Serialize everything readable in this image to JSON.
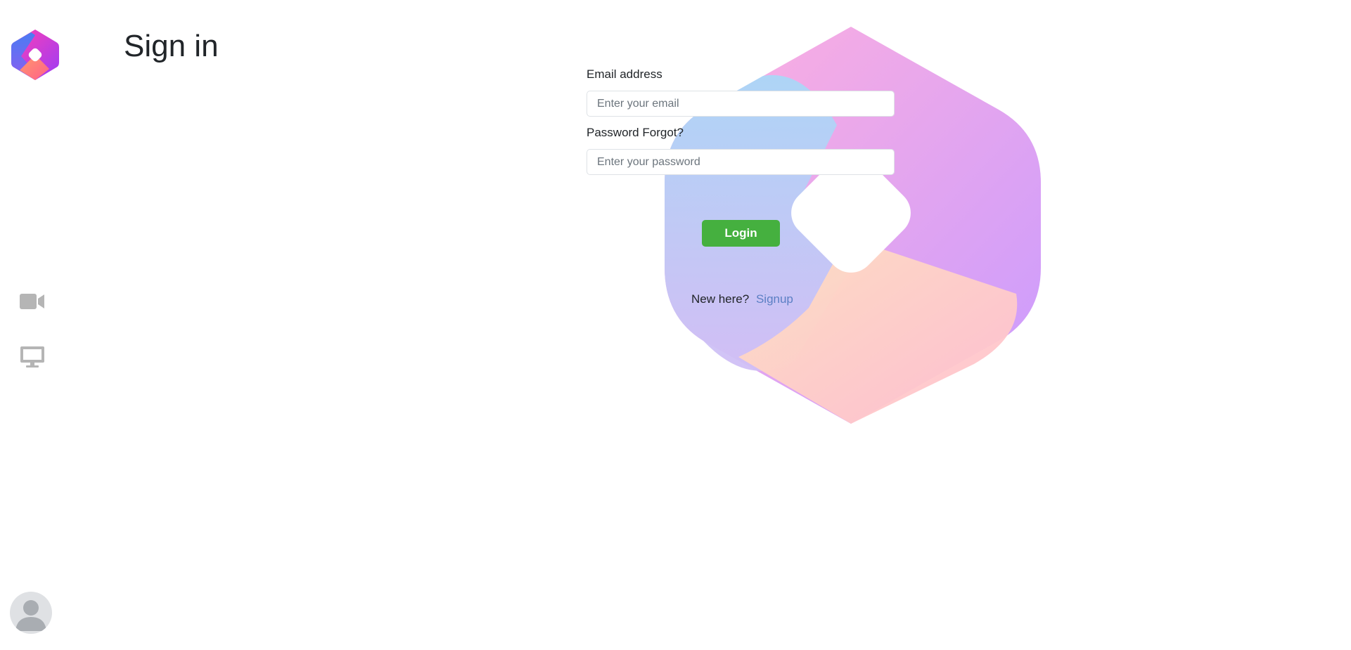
{
  "page": {
    "title": "Sign in"
  },
  "sidebar": {
    "logo_icon": "app-logo-icon",
    "items": [
      {
        "icon": "video-camera-icon"
      },
      {
        "icon": "monitor-icon"
      }
    ],
    "avatar_icon": "user-avatar-icon"
  },
  "form": {
    "email": {
      "label": "Email address",
      "value": "",
      "placeholder": "Enter your email"
    },
    "password": {
      "label": "Password Forgot?",
      "value": "",
      "placeholder": "Enter your password"
    },
    "login_label": "Login",
    "signup_prompt": "New here?",
    "signup_link": "Signup"
  },
  "colors": {
    "login_button": "#45b03f",
    "signup_link": "#5b7fc4",
    "icon_gray": "#b5b5b5"
  }
}
